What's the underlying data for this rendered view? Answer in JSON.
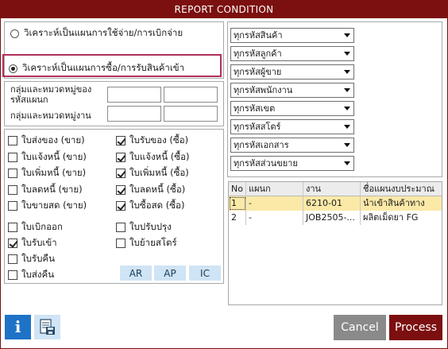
{
  "window": {
    "title": "REPORT CONDITION"
  },
  "analysis": {
    "options": [
      {
        "label": "วิเคราะห์เป็นแผนการใช้จ่าย/การเบิกจ่าย",
        "selected": false
      },
      {
        "label": "วิเคราะห์เป็นแผนการซื้อ/การรับสินค้าเข้า",
        "selected": true
      }
    ]
  },
  "groups": {
    "dept_label": "กลุ่มและหมวดหมู่ของ รหัสแผนก",
    "dept_label_1": "กลุ่มและหมวดหมู่ของ",
    "dept_label_2": "รหัสแผนก",
    "job_label": "กลุ่มและหมวดหมู่งาน",
    "dept_from": "",
    "dept_to": "",
    "job_from": "",
    "job_to": ""
  },
  "sales_docs": [
    {
      "label": "ใบส่งของ (ขาย)",
      "checked": false
    },
    {
      "label": "ใบแจ้งหนี้ (ขาย)",
      "checked": false
    },
    {
      "label": "ใบเพิ่มหนี้ (ขาย)",
      "checked": false
    },
    {
      "label": "ใบลดหนี้ (ขาย)",
      "checked": false
    },
    {
      "label": "ใบขายสด (ขาย)",
      "checked": false
    }
  ],
  "purchase_docs": [
    {
      "label": "ใบรับของ (ซื้อ)",
      "checked": true
    },
    {
      "label": "ใบแจ้งหนี้ (ซื้อ)",
      "checked": true
    },
    {
      "label": "ใบเพิ่มหนี้ (ซื้อ)",
      "checked": true
    },
    {
      "label": "ใบลดหนี้ (ซื้อ)",
      "checked": true
    },
    {
      "label": "ใบซื้อสด (ซื้อ)",
      "checked": true
    }
  ],
  "inventory_docs_left": [
    {
      "label": "ใบเบิกออก",
      "checked": false
    },
    {
      "label": "ใบรับเข้า",
      "checked": true
    },
    {
      "label": "ใบรับคืน",
      "checked": false
    },
    {
      "label": "ใบส่งคืน",
      "checked": false
    }
  ],
  "inventory_docs_right": [
    {
      "label": "ใบปรับปรุง",
      "checked": false
    },
    {
      "label": "ใบย้ายสโตร์",
      "checked": false
    }
  ],
  "quick_buttons": {
    "ar": "AR",
    "ap": "AP",
    "ic": "IC"
  },
  "filters": [
    {
      "name": "product",
      "value": "ทุกรหัสสินค้า"
    },
    {
      "name": "customer",
      "value": "ทุกรหัสลูกค้า"
    },
    {
      "name": "salesperson",
      "value": "ทุกรหัสผู้ขาย"
    },
    {
      "name": "employee",
      "value": "ทุกรหัสพนักงาน"
    },
    {
      "name": "zone",
      "value": "ทุกรหัสเขต"
    },
    {
      "name": "store",
      "value": "ทุกรหัสสโตร์"
    },
    {
      "name": "document",
      "value": "ทุกรหัสเอกสาร"
    },
    {
      "name": "discount",
      "value": "ทุกรหัสส่วนขยาย"
    }
  ],
  "budget_table": {
    "columns": [
      "No",
      "แผนก",
      "งาน",
      "ชื่อแผนงบประมาณ"
    ],
    "rows": [
      {
        "no": "1",
        "dept": "-",
        "job": "6210-01",
        "plan": "นำเข้าสินค้าทาง"
      },
      {
        "no": "2",
        "dept": "-",
        "job": "JOB2505-...",
        "plan": "ผลิตเม็ดยา FG"
      }
    ]
  },
  "footer": {
    "info_symbol": "i",
    "cancel_label": "Cancel",
    "process_label": "Process"
  },
  "colors": {
    "title_bar": "#7c0f0f",
    "highlight_border": "#b0305a",
    "selected_row": "#fbe9a8",
    "info_button": "#1e73c7"
  },
  "icons": {
    "info": "info-icon",
    "export": "export-document-icon"
  }
}
